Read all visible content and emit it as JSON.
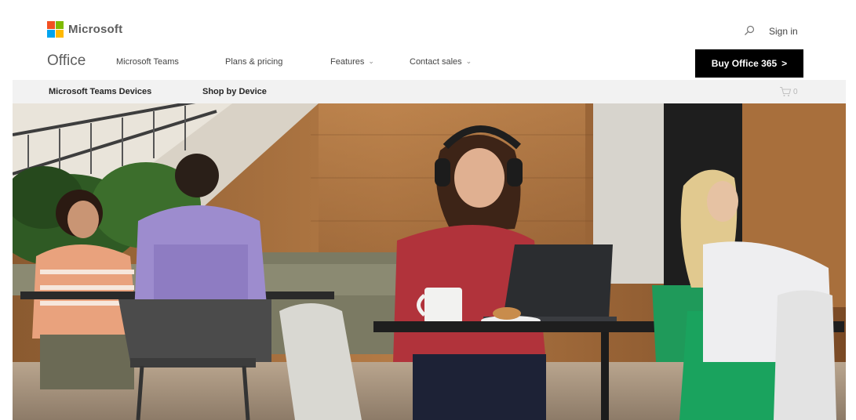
{
  "brand": {
    "name": "Microsoft"
  },
  "header": {
    "sign_in": "Sign in",
    "search_icon": "search-icon"
  },
  "product_nav": {
    "title": "Office",
    "items": [
      {
        "label": "Microsoft Teams",
        "has_dropdown": false
      },
      {
        "label": "Plans & pricing",
        "has_dropdown": false
      },
      {
        "label": "Features",
        "has_dropdown": true
      },
      {
        "label": "Contact sales",
        "has_dropdown": true
      }
    ],
    "cta": {
      "label": "Buy Office 365",
      "arrow": ">"
    }
  },
  "sub_nav": {
    "items": [
      {
        "label": "Microsoft Teams Devices"
      },
      {
        "label": "Shop by Device"
      }
    ],
    "cart": {
      "count": "0",
      "icon": "cart-icon"
    }
  },
  "hero": {
    "scene": "office-cafe-photo"
  },
  "colors": {
    "ms_red": "#f25022",
    "ms_green": "#7fba00",
    "ms_blue": "#00a4ef",
    "ms_yellow": "#ffb900",
    "cta_bg": "#000000",
    "subnav_bg": "#f2f2f2"
  }
}
